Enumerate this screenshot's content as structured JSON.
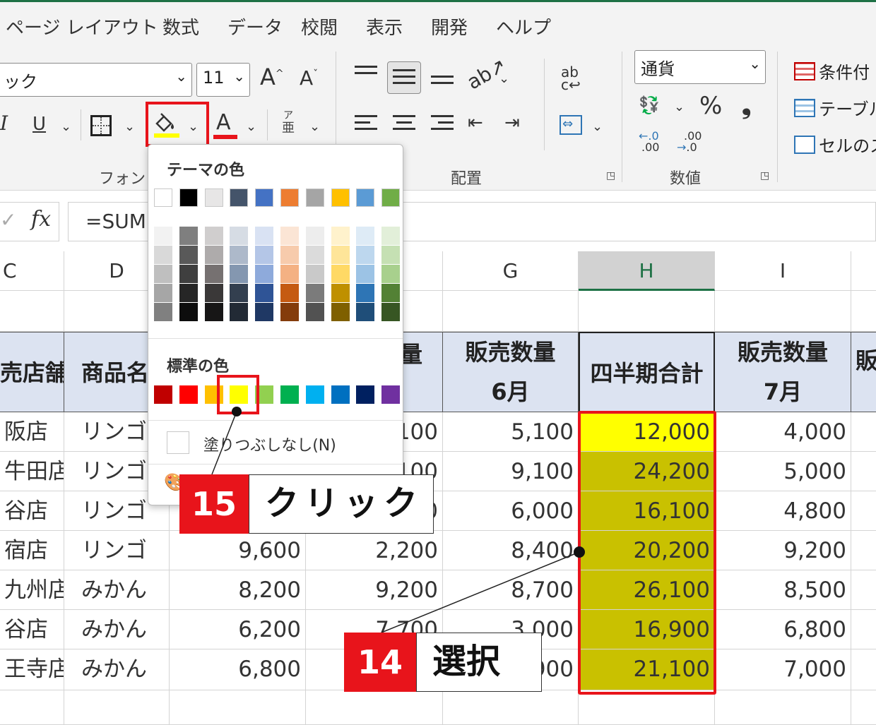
{
  "menu": [
    "ページ レイアウト",
    "数式",
    "データ",
    "校閲",
    "表示",
    "開発",
    "ヘルプ"
  ],
  "ribbon": {
    "font_name": "ック",
    "font_size": "11",
    "grow_font": "A",
    "shrink_font": "A",
    "italic": "I",
    "underline": "U",
    "font_color_letter": "A",
    "phonetic_top": "ア",
    "phonetic_bottom": "亜",
    "wrap_text": "ab",
    "font_group_label": "フォント",
    "align_group_label": "配置",
    "number_format": "通貨",
    "percent": "%",
    "comma": "❟",
    "number_group_label": "数値",
    "inc_decimal_top": ".0",
    "inc_decimal_bottom": ".00",
    "dec_decimal_top": ".00",
    "dec_decimal_bottom": ".0",
    "conditional_format": "条件付",
    "format_table": "テーブル",
    "cell_styles": "セルのス",
    "fill_color_underline": "#ffff00",
    "font_color_underline": "#e8141b"
  },
  "formula_bar": {
    "fx": "fx",
    "check": "✓",
    "formula": "=SUM"
  },
  "columns": [
    "C",
    "D",
    "G",
    "H",
    "I"
  ],
  "headers": {
    "C": "売店舗",
    "D": "商品名",
    "F_partial": "量",
    "G_line1": "販売数量",
    "G_line2": "6月",
    "H": "四半期合計",
    "I_line1": "販売数量",
    "I_line2": "7月",
    "J_partial": "販"
  },
  "rows": [
    {
      "store": "阪店",
      "product": "リンゴ",
      "e": "",
      "f": "100",
      "g": "5,100",
      "h": "12,000",
      "i": "4,000"
    },
    {
      "store": "牛田店",
      "product": "リンゴ",
      "e": "",
      "f": "100",
      "g": "9,100",
      "h": "24,200",
      "i": "5,000"
    },
    {
      "store": "谷店",
      "product": "リンゴ",
      "e": "",
      "f": "0",
      "g": "6,000",
      "h": "16,100",
      "i": "4,800"
    },
    {
      "store": "宿店",
      "product": "リンゴ",
      "e": "9,600",
      "f": "2,200",
      "g": "8,400",
      "h": "20,200",
      "i": "9,200"
    },
    {
      "store": "九州店",
      "product": "みかん",
      "e": "8,200",
      "f": "9,200",
      "g": "8,700",
      "h": "26,100",
      "i": "8,500"
    },
    {
      "store": "谷店",
      "product": "みかん",
      "e": "6,200",
      "f": "7,700",
      "g": "3,000",
      "h": "16,900",
      "i": "6,800"
    },
    {
      "store": "王寺店",
      "product": "みかん",
      "e": "6,800",
      "f": "",
      "g": "900",
      "h": "21,100",
      "i": "7,000"
    }
  ],
  "palette": {
    "theme_title": "テーマの色",
    "standard_title": "標準の色",
    "no_fill": "塗りつぶしなし(N)",
    "theme_colors": [
      "#ffffff",
      "#000000",
      "#e7e6e6",
      "#44546a",
      "#4472c4",
      "#ed7d31",
      "#a5a5a5",
      "#ffc000",
      "#5b9bd5",
      "#70ad47"
    ],
    "theme_shades": [
      [
        "#f2f2f2",
        "#d9d9d9",
        "#bfbfbf",
        "#a6a6a6",
        "#808080"
      ],
      [
        "#7f7f7f",
        "#595959",
        "#3f3f3f",
        "#262626",
        "#0d0d0d"
      ],
      [
        "#d0cece",
        "#aeabab",
        "#767171",
        "#3a3838",
        "#171616"
      ],
      [
        "#d6dce4",
        "#adb9ca",
        "#8497b0",
        "#333f4f",
        "#222a35"
      ],
      [
        "#d9e2f3",
        "#b4c6e7",
        "#8eaadb",
        "#2f5496",
        "#1f3864"
      ],
      [
        "#fbe5d5",
        "#f7cbac",
        "#f4b183",
        "#c55a11",
        "#843c0b"
      ],
      [
        "#ededed",
        "#dbdbdb",
        "#c9c9c9",
        "#7b7b7b",
        "#525252"
      ],
      [
        "#fff2cc",
        "#fee599",
        "#ffd965",
        "#bf9000",
        "#7f6000"
      ],
      [
        "#deebf6",
        "#bdd7ee",
        "#9cc3e5",
        "#2e75b5",
        "#1f4e79"
      ],
      [
        "#e2efd9",
        "#c5e0b3",
        "#a8d08d",
        "#538135",
        "#375623"
      ]
    ],
    "standard_colors": [
      "#c00000",
      "#ff0000",
      "#ffc000",
      "#ffff00",
      "#92d050",
      "#00b050",
      "#00b0f0",
      "#0070c0",
      "#002060",
      "#7030a0"
    ]
  },
  "callouts": {
    "step15_number": "15",
    "step15_text": "クリック",
    "step14_number": "14",
    "step14_text": "選択"
  }
}
